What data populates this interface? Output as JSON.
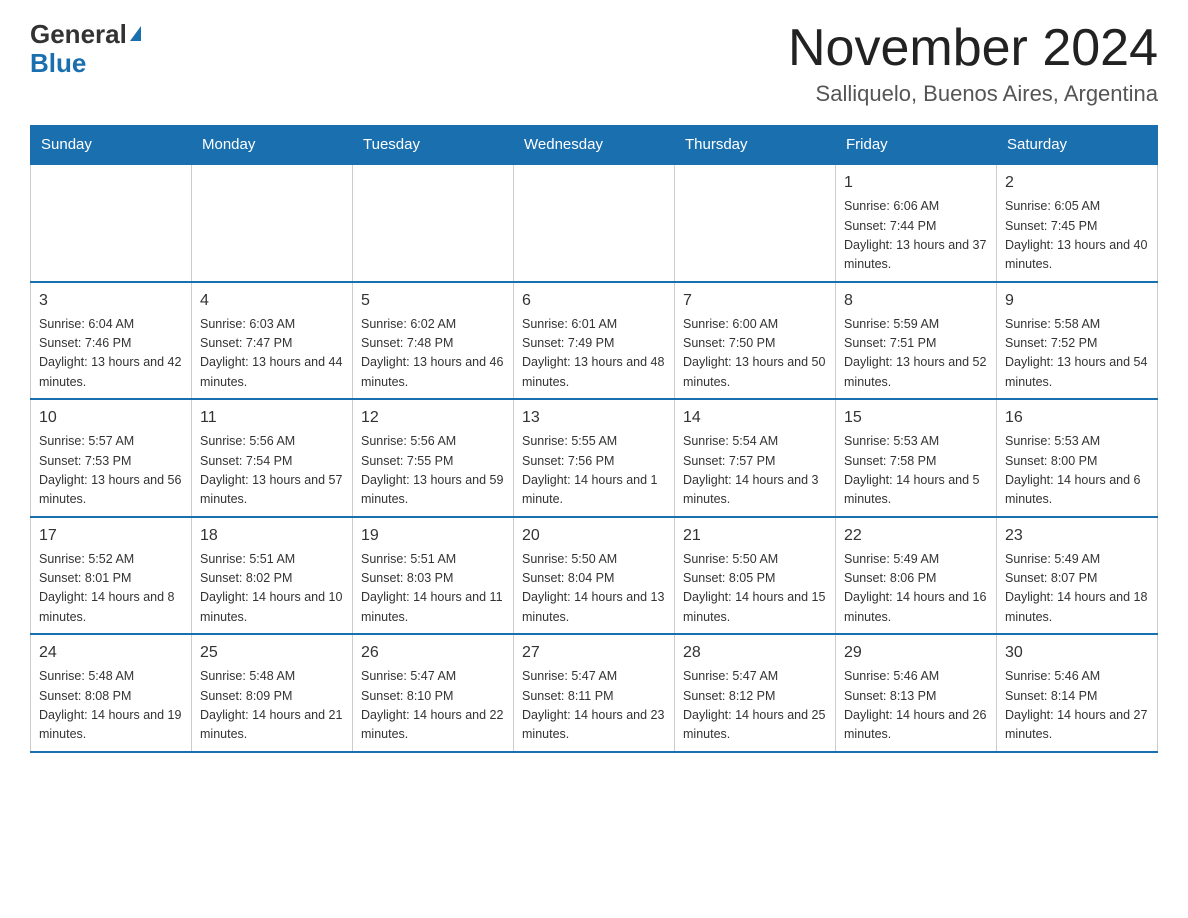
{
  "header": {
    "logo": {
      "general": "General",
      "blue": "Blue",
      "triangle_desc": "blue triangle logo mark"
    },
    "title": "November 2024",
    "location": "Salliquelo, Buenos Aires, Argentina"
  },
  "calendar": {
    "days_of_week": [
      "Sunday",
      "Monday",
      "Tuesday",
      "Wednesday",
      "Thursday",
      "Friday",
      "Saturday"
    ],
    "weeks": [
      [
        {
          "day": "",
          "info": ""
        },
        {
          "day": "",
          "info": ""
        },
        {
          "day": "",
          "info": ""
        },
        {
          "day": "",
          "info": ""
        },
        {
          "day": "",
          "info": ""
        },
        {
          "day": "1",
          "info": "Sunrise: 6:06 AM\nSunset: 7:44 PM\nDaylight: 13 hours and 37 minutes."
        },
        {
          "day": "2",
          "info": "Sunrise: 6:05 AM\nSunset: 7:45 PM\nDaylight: 13 hours and 40 minutes."
        }
      ],
      [
        {
          "day": "3",
          "info": "Sunrise: 6:04 AM\nSunset: 7:46 PM\nDaylight: 13 hours and 42 minutes."
        },
        {
          "day": "4",
          "info": "Sunrise: 6:03 AM\nSunset: 7:47 PM\nDaylight: 13 hours and 44 minutes."
        },
        {
          "day": "5",
          "info": "Sunrise: 6:02 AM\nSunset: 7:48 PM\nDaylight: 13 hours and 46 minutes."
        },
        {
          "day": "6",
          "info": "Sunrise: 6:01 AM\nSunset: 7:49 PM\nDaylight: 13 hours and 48 minutes."
        },
        {
          "day": "7",
          "info": "Sunrise: 6:00 AM\nSunset: 7:50 PM\nDaylight: 13 hours and 50 minutes."
        },
        {
          "day": "8",
          "info": "Sunrise: 5:59 AM\nSunset: 7:51 PM\nDaylight: 13 hours and 52 minutes."
        },
        {
          "day": "9",
          "info": "Sunrise: 5:58 AM\nSunset: 7:52 PM\nDaylight: 13 hours and 54 minutes."
        }
      ],
      [
        {
          "day": "10",
          "info": "Sunrise: 5:57 AM\nSunset: 7:53 PM\nDaylight: 13 hours and 56 minutes."
        },
        {
          "day": "11",
          "info": "Sunrise: 5:56 AM\nSunset: 7:54 PM\nDaylight: 13 hours and 57 minutes."
        },
        {
          "day": "12",
          "info": "Sunrise: 5:56 AM\nSunset: 7:55 PM\nDaylight: 13 hours and 59 minutes."
        },
        {
          "day": "13",
          "info": "Sunrise: 5:55 AM\nSunset: 7:56 PM\nDaylight: 14 hours and 1 minute."
        },
        {
          "day": "14",
          "info": "Sunrise: 5:54 AM\nSunset: 7:57 PM\nDaylight: 14 hours and 3 minutes."
        },
        {
          "day": "15",
          "info": "Sunrise: 5:53 AM\nSunset: 7:58 PM\nDaylight: 14 hours and 5 minutes."
        },
        {
          "day": "16",
          "info": "Sunrise: 5:53 AM\nSunset: 8:00 PM\nDaylight: 14 hours and 6 minutes."
        }
      ],
      [
        {
          "day": "17",
          "info": "Sunrise: 5:52 AM\nSunset: 8:01 PM\nDaylight: 14 hours and 8 minutes."
        },
        {
          "day": "18",
          "info": "Sunrise: 5:51 AM\nSunset: 8:02 PM\nDaylight: 14 hours and 10 minutes."
        },
        {
          "day": "19",
          "info": "Sunrise: 5:51 AM\nSunset: 8:03 PM\nDaylight: 14 hours and 11 minutes."
        },
        {
          "day": "20",
          "info": "Sunrise: 5:50 AM\nSunset: 8:04 PM\nDaylight: 14 hours and 13 minutes."
        },
        {
          "day": "21",
          "info": "Sunrise: 5:50 AM\nSunset: 8:05 PM\nDaylight: 14 hours and 15 minutes."
        },
        {
          "day": "22",
          "info": "Sunrise: 5:49 AM\nSunset: 8:06 PM\nDaylight: 14 hours and 16 minutes."
        },
        {
          "day": "23",
          "info": "Sunrise: 5:49 AM\nSunset: 8:07 PM\nDaylight: 14 hours and 18 minutes."
        }
      ],
      [
        {
          "day": "24",
          "info": "Sunrise: 5:48 AM\nSunset: 8:08 PM\nDaylight: 14 hours and 19 minutes."
        },
        {
          "day": "25",
          "info": "Sunrise: 5:48 AM\nSunset: 8:09 PM\nDaylight: 14 hours and 21 minutes."
        },
        {
          "day": "26",
          "info": "Sunrise: 5:47 AM\nSunset: 8:10 PM\nDaylight: 14 hours and 22 minutes."
        },
        {
          "day": "27",
          "info": "Sunrise: 5:47 AM\nSunset: 8:11 PM\nDaylight: 14 hours and 23 minutes."
        },
        {
          "day": "28",
          "info": "Sunrise: 5:47 AM\nSunset: 8:12 PM\nDaylight: 14 hours and 25 minutes."
        },
        {
          "day": "29",
          "info": "Sunrise: 5:46 AM\nSunset: 8:13 PM\nDaylight: 14 hours and 26 minutes."
        },
        {
          "day": "30",
          "info": "Sunrise: 5:46 AM\nSunset: 8:14 PM\nDaylight: 14 hours and 27 minutes."
        }
      ]
    ]
  }
}
